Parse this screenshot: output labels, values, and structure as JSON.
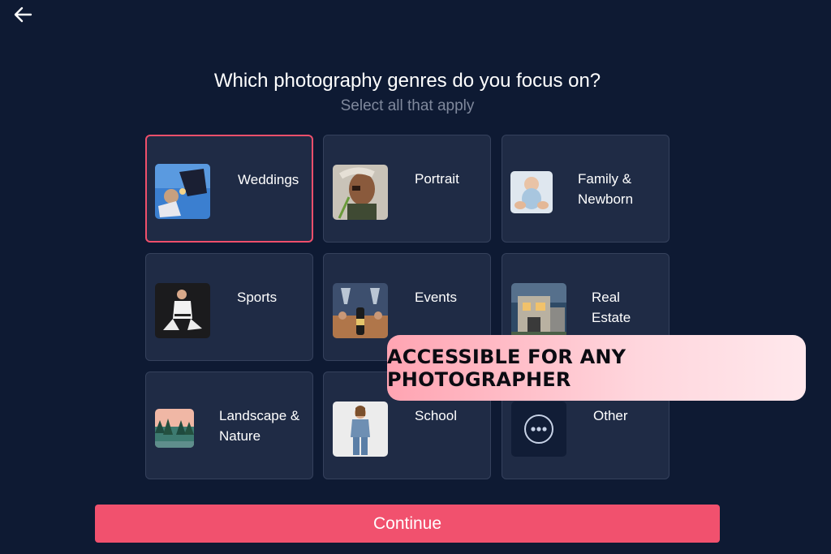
{
  "header": {
    "back_icon": "arrow-left-icon",
    "title": "Which photography genres do you focus on?",
    "subtitle": "Select all that apply"
  },
  "genres": [
    {
      "label": "Weddings",
      "selected": true,
      "icon": "wedding-photo-thumbnail"
    },
    {
      "label": "Portrait",
      "selected": false,
      "icon": "portrait-photo-thumbnail"
    },
    {
      "label": "Family &\nNewborn",
      "selected": false,
      "icon": "newborn-photo-thumbnail"
    },
    {
      "label": "Sports",
      "selected": false,
      "icon": "sports-photo-thumbnail"
    },
    {
      "label": "Events",
      "selected": false,
      "icon": "events-photo-thumbnail"
    },
    {
      "label": "Real\nEstate",
      "selected": false,
      "icon": "real-estate-photo-thumbnail"
    },
    {
      "label": "Landscape &\nNature",
      "selected": false,
      "icon": "landscape-photo-thumbnail"
    },
    {
      "label": "School",
      "selected": false,
      "icon": "school-photo-thumbnail"
    },
    {
      "label": "Other",
      "selected": false,
      "icon": "more-dots-icon"
    }
  ],
  "continue_label": "Continue",
  "promo_banner": {
    "text": "ACCESSIBLE FOR ANY PHOTOGRAPHER"
  },
  "colors": {
    "background": "#0e1a33",
    "card": "#1f2b45",
    "accent": "#f1516e",
    "selected_border": "#ef4f6b"
  }
}
